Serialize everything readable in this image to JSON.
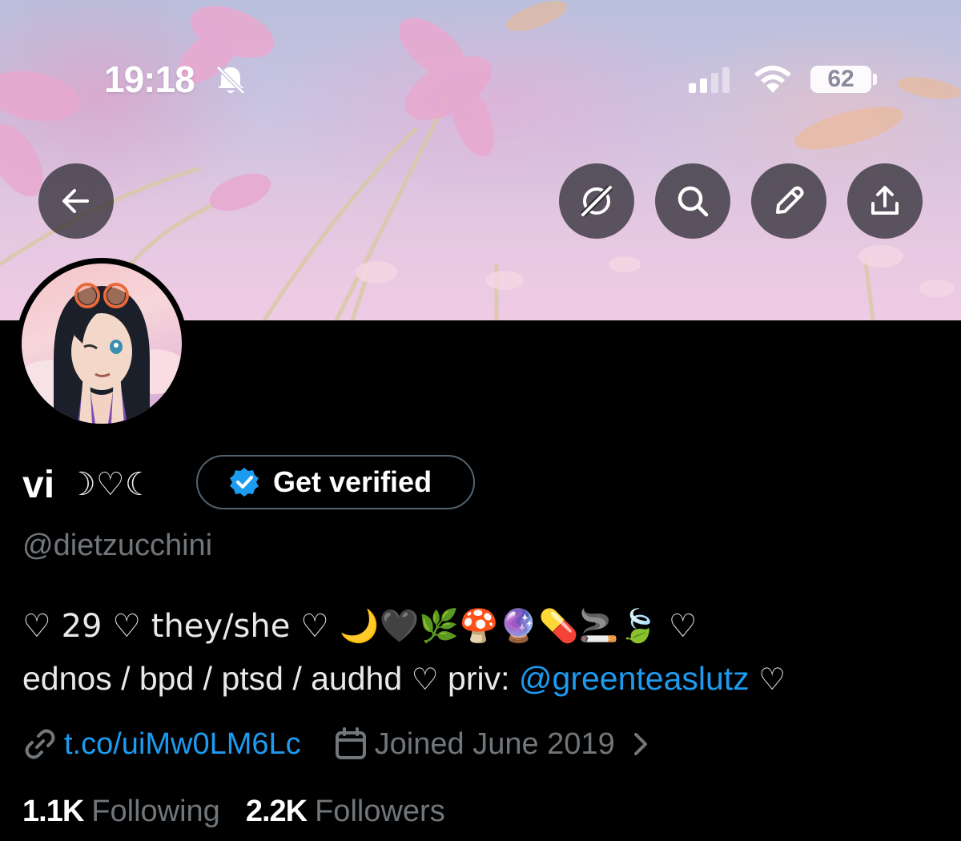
{
  "status_bar": {
    "time": "19:18",
    "battery": "62",
    "icons": [
      "bell-slash-icon",
      "cellular-signal-icon",
      "wifi-icon",
      "battery-icon"
    ]
  },
  "header": {
    "buttons": [
      {
        "name": "back-button",
        "icon": "arrow-left-icon"
      },
      {
        "name": "grok-button",
        "icon": "grok-icon"
      },
      {
        "name": "search-button",
        "icon": "search-icon"
      },
      {
        "name": "edit-button",
        "icon": "pencil-icon"
      },
      {
        "name": "share-button",
        "icon": "share-icon"
      }
    ]
  },
  "profile": {
    "display_name": "vi",
    "name_symbols": "☽♡☾",
    "get_verified_label": "Get verified",
    "handle": "@dietzucchini",
    "bio_line1": "♡ 29 ♡ they/she ♡ 🌙🖤🌿🍄🔮💊🚬🍃 ♡",
    "bio_line2_text": "ednos / bpd / ptsd / audhd",
    "bio_line2_priv": "priv: ",
    "bio_line2_heart": "♡",
    "bio_mention": "@greenteaslutz",
    "link": "t.co/uiMw0LM6Lc",
    "joined": "Joined June 2019",
    "following_count": "1.1K",
    "following_label": "Following",
    "followers_count": "2.2K",
    "followers_label": "Followers"
  },
  "colors": {
    "background": "#000000",
    "accent": "#1d9bf0",
    "secondary_text": "#71767b",
    "primary_text": "#e7e9ea"
  }
}
